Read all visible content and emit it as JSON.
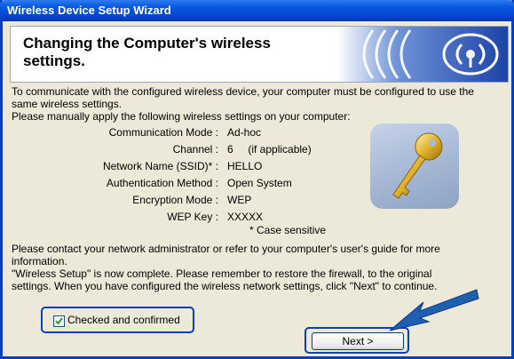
{
  "window": {
    "title": "Wireless Device Setup Wizard"
  },
  "banner": {
    "title_line1": "Changing the Computer's wireless",
    "title_line2": "settings."
  },
  "intro": {
    "line1": "To communicate with the configured wireless device, your computer must be configured to use the",
    "line2": "same wireless settings.",
    "line3": "Please manually apply the following wireless settings on your computer:"
  },
  "settings": [
    {
      "label": "Communication Mode :",
      "value": "Ad-hoc"
    },
    {
      "label": "Channel :",
      "value": "6     (if applicable)"
    },
    {
      "label": "Network Name (SSID)* :",
      "value": "HELLO"
    },
    {
      "label": "Authentication Method :",
      "value": "Open System"
    },
    {
      "label": "Encryption Mode :",
      "value": "WEP"
    },
    {
      "label": "WEP Key :",
      "value": "XXXXX"
    }
  ],
  "case_note": "* Case sensitive",
  "footer": {
    "line1": "Please contact your network administrator or refer to your computer's user's guide for more",
    "line2": "information.",
    "line3": "\"Wireless Setup\" is now complete. Please remember to restore the firewall, to the original",
    "line4": "settings. When you have configured the wireless network settings, click \"Next\" to continue."
  },
  "checkbox": {
    "label": "Checked and confirmed",
    "checked": true
  },
  "buttons": {
    "next": "Next >"
  },
  "colors": {
    "titlebar": "#0a5ae0",
    "dialog_bg": "#ece9d8",
    "highlight_border": "#0a3fb8",
    "arrow": "#1f5fb0"
  },
  "icons": {
    "banner": "wireless-signal-icon",
    "art": "key-icon",
    "pointer": "arrow-pointer-icon"
  }
}
